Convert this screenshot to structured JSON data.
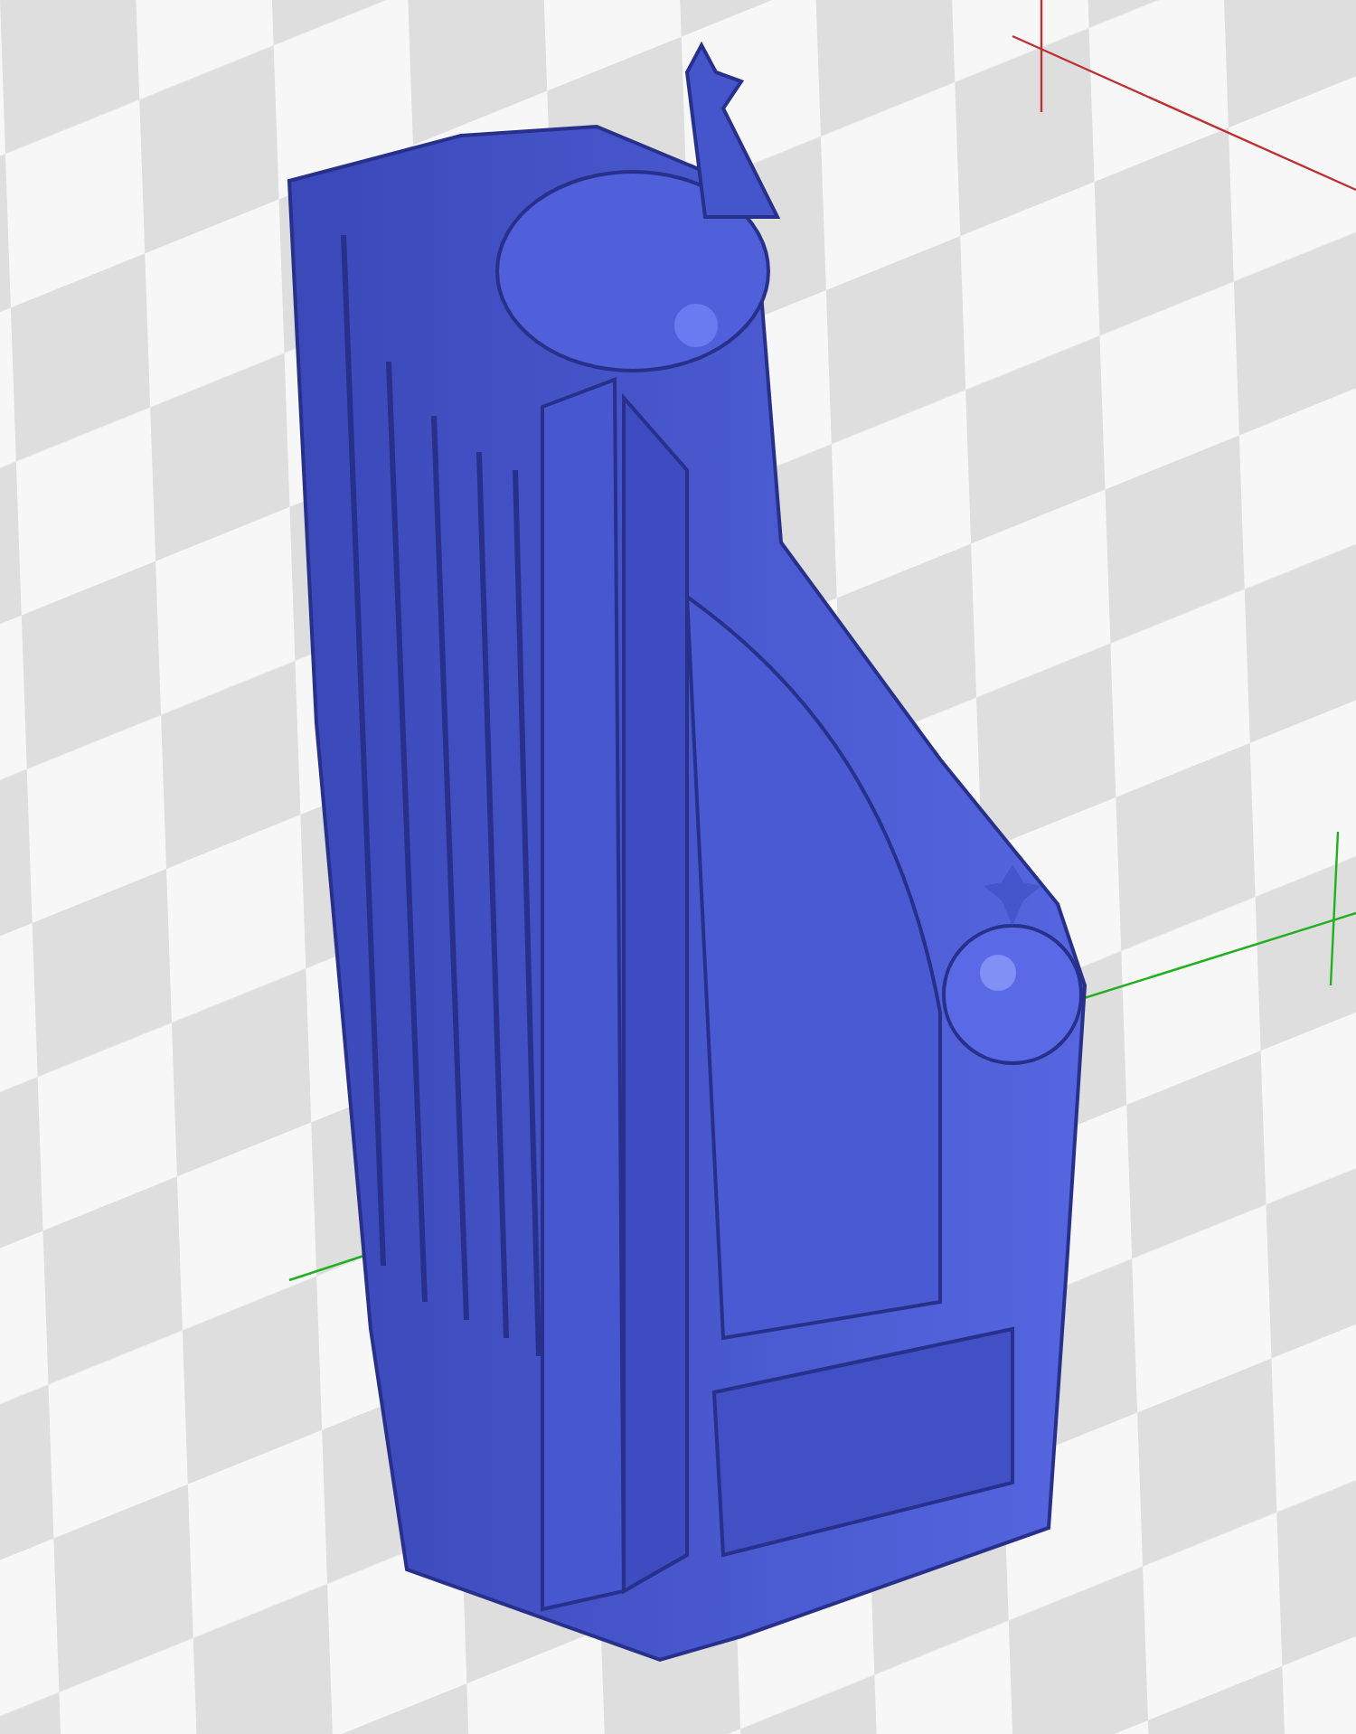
{
  "viewport": {
    "floor_grid": true,
    "axes": true
  }
}
